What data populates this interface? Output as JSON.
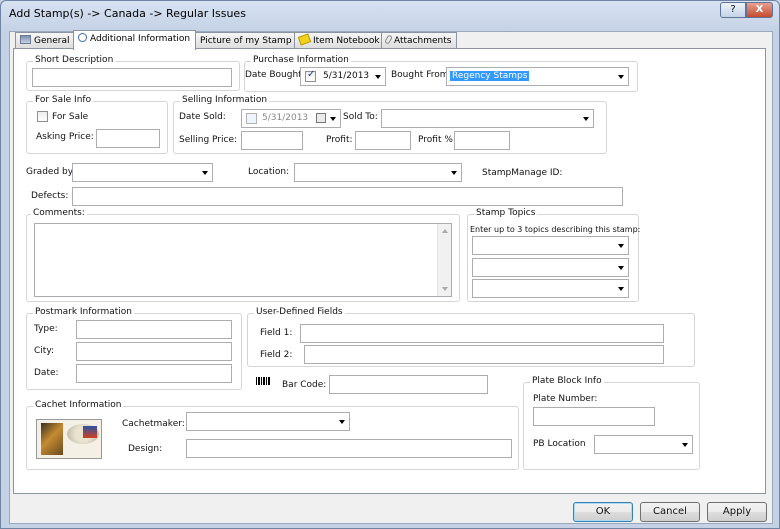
{
  "window": {
    "title": "Add Stamp(s) -> Canada -> Regular Issues",
    "help_label": "?",
    "close_label": "X"
  },
  "tabs": [
    {
      "label": "General",
      "icon": "general-icon"
    },
    {
      "label": "Additional Information",
      "icon": "info-icon",
      "active": true
    },
    {
      "label": "Picture of my Stamp",
      "icon": "pencil-icon"
    },
    {
      "label": "Item Notebook",
      "icon": "notebook-icon"
    },
    {
      "label": "Attachments",
      "icon": "paperclip-icon"
    }
  ],
  "short_description": {
    "legend": "Short Description",
    "value": ""
  },
  "purchase": {
    "legend": "Purchase Information",
    "date_bought_label": "Date Bought:",
    "date_bought_checked": true,
    "date_bought_value": "5/31/2013",
    "bought_from_label": "Bought From:",
    "bought_from_value": "Regency Stamps"
  },
  "for_sale": {
    "legend": "For Sale Info",
    "for_sale_label": "For Sale",
    "for_sale_checked": false,
    "asking_price_label": "Asking Price:",
    "asking_price_value": ""
  },
  "selling": {
    "legend": "Selling Information",
    "date_sold_label": "Date Sold:",
    "date_sold_value": "5/31/2013",
    "sold_to_label": "Sold To:",
    "sold_to_value": "",
    "selling_price_label": "Selling Price:",
    "selling_price_value": "",
    "profit_label": "Profit:",
    "profit_value": "",
    "profit_pct_label": "Profit %",
    "profit_pct_value": ""
  },
  "graded_by": {
    "label": "Graded by:",
    "value": ""
  },
  "location": {
    "label": "Location:",
    "value": ""
  },
  "stampmanage_id": {
    "label": "StampManage ID:",
    "value": ""
  },
  "defects": {
    "label": "Defects:",
    "value": ""
  },
  "comments": {
    "legend": "Comments:",
    "value": ""
  },
  "stamp_topics": {
    "legend": "Stamp Topics",
    "hint": "Enter up to 3 topics describing this stamp:",
    "topics": [
      "",
      "",
      ""
    ]
  },
  "postmark": {
    "legend": "Postmark Information",
    "type_label": "Type:",
    "type_value": "",
    "city_label": "City:",
    "city_value": "",
    "date_label": "Date:",
    "date_value": ""
  },
  "user_defined": {
    "legend": "User-Defined Fields",
    "field1_label": "Field 1:",
    "field1_value": "",
    "field2_label": "Field 2:",
    "field2_value": ""
  },
  "barcode": {
    "label": "Bar Code:",
    "value": ""
  },
  "cachet": {
    "legend": "Cachet Information",
    "cachetmaker_label": "Cachetmaker:",
    "cachetmaker_value": "",
    "design_label": "Design:",
    "design_value": ""
  },
  "plate_block": {
    "legend": "Plate Block Info",
    "plate_number_label": "Plate Number:",
    "plate_number_value": "",
    "pb_location_label": "PB Location",
    "pb_location_value": ""
  },
  "buttons": {
    "ok": "OK",
    "cancel": "Cancel",
    "apply": "Apply"
  }
}
